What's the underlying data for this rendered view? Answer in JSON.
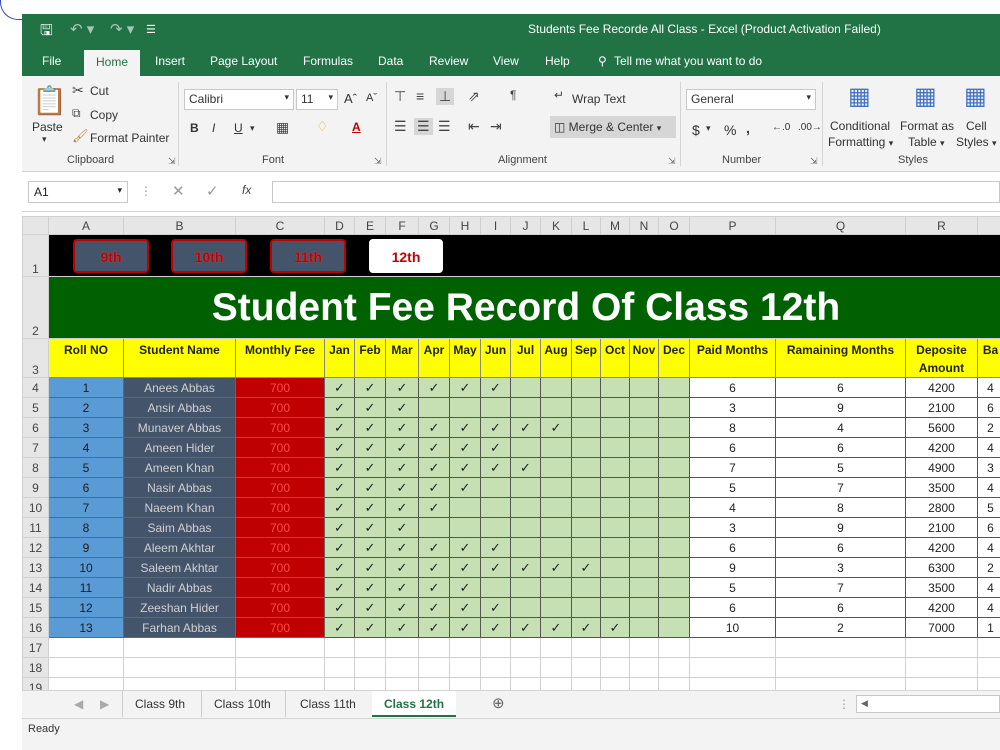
{
  "window": {
    "title": "Students Fee Recorde All Class  -  Excel (Product Activation Failed)"
  },
  "quick_access": {
    "save_icon": "save-icon",
    "undo_icon": "undo-icon",
    "redo_icon": "redo-icon"
  },
  "ribbon_tabs": [
    "File",
    "Home",
    "Insert",
    "Page Layout",
    "Formulas",
    "Data",
    "Review",
    "View",
    "Help"
  ],
  "tell_me": "Tell me what you want to do",
  "clipboard": {
    "paste": "Paste",
    "cut": "Cut",
    "copy": "Copy",
    "format_painter": "Format Painter",
    "label": "Clipboard"
  },
  "font": {
    "name": "Calibri",
    "size": "11",
    "bold": "B",
    "italic": "I",
    "underline": "U",
    "label": "Font"
  },
  "alignment": {
    "wrap_text": "Wrap Text",
    "merge_center": "Merge & Center",
    "label": "Alignment"
  },
  "number": {
    "format": "General",
    "currency": "$",
    "percent": "%",
    "comma": ",",
    "label": "Number"
  },
  "styles": {
    "conditional": "Conditional",
    "conditional2": "Formatting",
    "format_as": "Format as",
    "format_as2": "Table",
    "cell": "Cell",
    "cell2": "Styles",
    "label": "Styles"
  },
  "formula_bar": {
    "name_box": "A1",
    "fx": "fx",
    "value": ""
  },
  "columns": [
    "A",
    "B",
    "C",
    "D",
    "E",
    "F",
    "G",
    "H",
    "I",
    "J",
    "K",
    "L",
    "M",
    "N",
    "O",
    "P",
    "Q",
    "R"
  ],
  "class_buttons": [
    "9th",
    "10th",
    "11th",
    "12th"
  ],
  "banner": "Student Fee Record Of Class 12th",
  "headers": {
    "roll": "Roll NO",
    "name": "Student Name",
    "fee": "Monthly Fee",
    "months": [
      "Jan",
      "Feb",
      "Mar",
      "Apr",
      "May",
      "Jun",
      "Jul",
      "Aug",
      "Sep",
      "Oct",
      "Nov",
      "Dec"
    ],
    "paid": "Paid Months",
    "remaining": "Ramaining Months",
    "deposit": "Deposite Amount",
    "balance": "Ba"
  },
  "students": [
    {
      "roll": "1",
      "name": "Anees Abbas",
      "fee": "700",
      "paid": "6",
      "rem": "6",
      "dep": "4200",
      "bal": "4"
    },
    {
      "roll": "2",
      "name": "Ansir Abbas",
      "fee": "700",
      "paid": "3",
      "rem": "9",
      "dep": "2100",
      "bal": "6"
    },
    {
      "roll": "3",
      "name": "Munaver Abbas",
      "fee": "700",
      "paid": "8",
      "rem": "4",
      "dep": "5600",
      "bal": "2"
    },
    {
      "roll": "4",
      "name": "Ameen Hider",
      "fee": "700",
      "paid": "6",
      "rem": "6",
      "dep": "4200",
      "bal": "4"
    },
    {
      "roll": "5",
      "name": "Ameen Khan",
      "fee": "700",
      "paid": "7",
      "rem": "5",
      "dep": "4900",
      "bal": "3"
    },
    {
      "roll": "6",
      "name": "Nasir Abbas",
      "fee": "700",
      "paid": "5",
      "rem": "7",
      "dep": "3500",
      "bal": "4"
    },
    {
      "roll": "7",
      "name": "Naeem Khan",
      "fee": "700",
      "paid": "4",
      "rem": "8",
      "dep": "2800",
      "bal": "5"
    },
    {
      "roll": "8",
      "name": "Saim Abbas",
      "fee": "700",
      "paid": "3",
      "rem": "9",
      "dep": "2100",
      "bal": "6"
    },
    {
      "roll": "9",
      "name": "Aleem Akhtar",
      "fee": "700",
      "paid": "6",
      "rem": "6",
      "dep": "4200",
      "bal": "4"
    },
    {
      "roll": "10",
      "name": "Saleem Akhtar",
      "fee": "700",
      "paid": "9",
      "rem": "3",
      "dep": "6300",
      "bal": "2"
    },
    {
      "roll": "11",
      "name": "Nadir Abbas",
      "fee": "700",
      "paid": "5",
      "rem": "7",
      "dep": "3500",
      "bal": "4"
    },
    {
      "roll": "12",
      "name": "Zeeshan Hider",
      "fee": "700",
      "paid": "6",
      "rem": "6",
      "dep": "4200",
      "bal": "4"
    },
    {
      "roll": "13",
      "name": "Farhan Abbas",
      "fee": "700",
      "paid": "10",
      "rem": "2",
      "dep": "7000",
      "bal": "1"
    }
  ],
  "check_mark": "✓",
  "row_numbers": [
    "1",
    "2",
    "3",
    "4",
    "5",
    "6",
    "7",
    "8",
    "9",
    "10",
    "11",
    "12",
    "13",
    "14",
    "15",
    "16",
    "17",
    "18",
    "19"
  ],
  "sheet_tabs": [
    "Class 9th",
    "Class 10th",
    "Class 11th",
    "Class 12th"
  ],
  "active_sheet": "Class 12th",
  "status": "Ready",
  "colors": {
    "excel_green": "#217346",
    "banner_green": "#006100",
    "header_yellow": "#ffff00",
    "roll_blue": "#5b9bd5",
    "name_slate": "#44546a",
    "fee_red": "#c00000",
    "month_green": "#c6e0b4"
  }
}
